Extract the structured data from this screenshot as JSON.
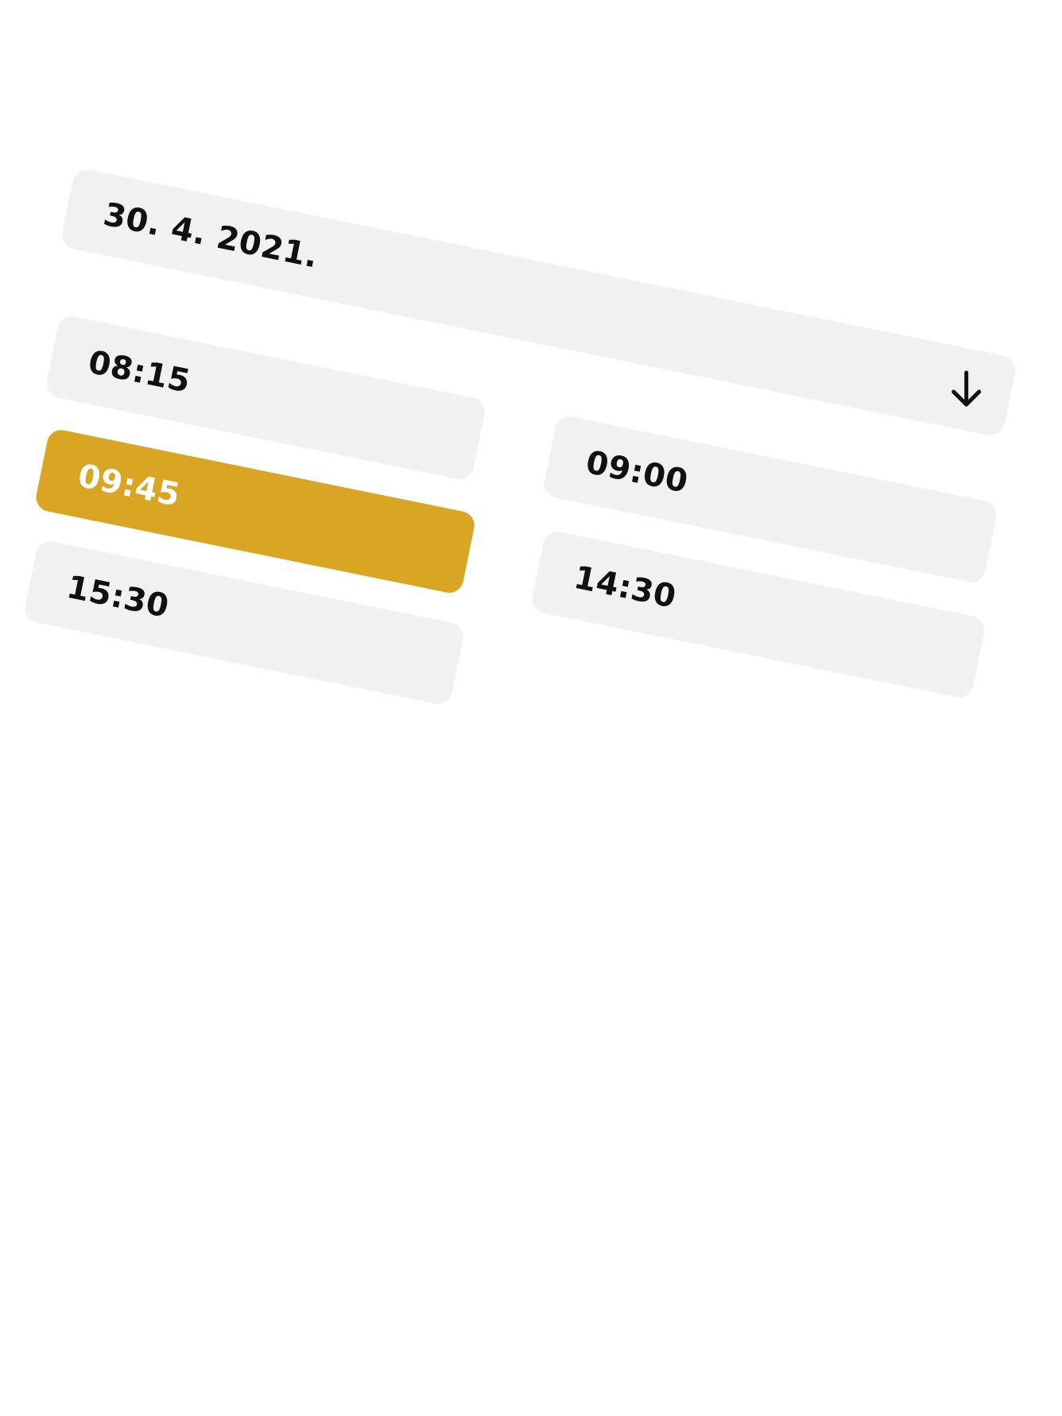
{
  "booking": {
    "date": {
      "value": "30. 4. 2021.",
      "icon": "arrow-down-icon"
    },
    "time_slots": [
      {
        "label": "08:15",
        "selected": false
      },
      {
        "label": "09:45",
        "selected": true
      },
      {
        "label": "15:30",
        "selected": false
      },
      {
        "label": "09:00",
        "selected": false
      },
      {
        "label": "14:30",
        "selected": false
      }
    ],
    "colors": {
      "slot_background": "#f1f1f1",
      "selected_background": "#d8a623",
      "selected_text": "#ffffff",
      "text": "#111111"
    }
  }
}
